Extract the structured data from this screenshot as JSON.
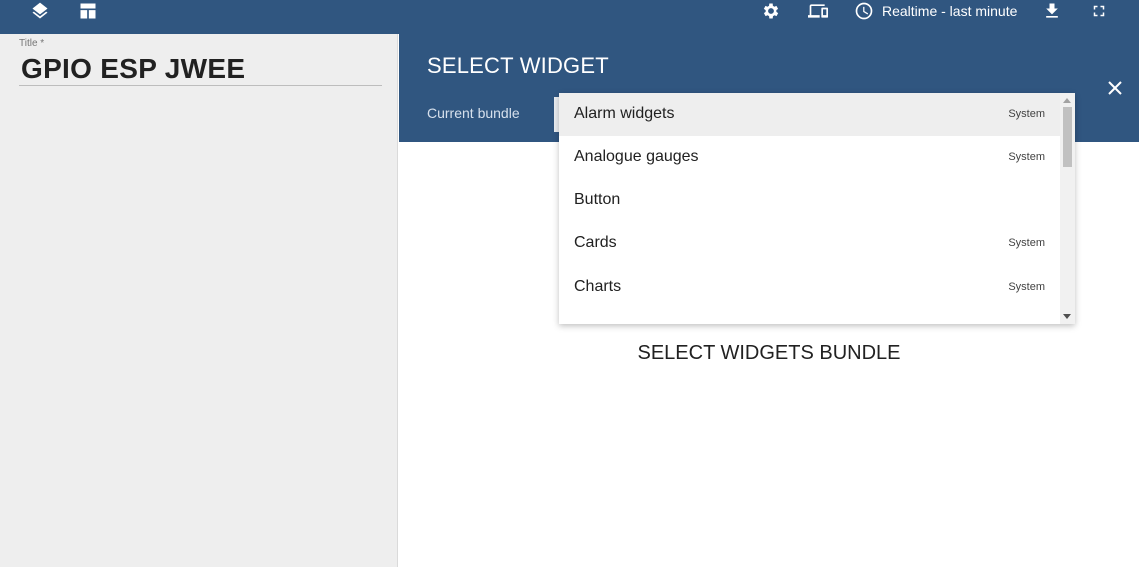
{
  "toolbar": {
    "left_icons": [
      "layers-icon",
      "dashboard-layout-icon"
    ],
    "right_icons": [
      "gear-icon",
      "devices-icon",
      "download-icon",
      "fullscreen-icon"
    ],
    "timewindow_label": "Realtime - last minute"
  },
  "left_panel": {
    "title_label": "Title *",
    "title_value": "GPIO ESP JWEE"
  },
  "right_panel": {
    "header_title": "SELECT WIDGET",
    "bundle_label": "Current bundle",
    "empty_message": "SELECT WIDGETS BUNDLE"
  },
  "bundle_dropdown": {
    "items": [
      {
        "name": "Alarm widgets",
        "tag": "System",
        "highlighted": true
      },
      {
        "name": "Analogue gauges",
        "tag": "System",
        "highlighted": false
      },
      {
        "name": "Button",
        "tag": "",
        "highlighted": false
      },
      {
        "name": "Cards",
        "tag": "System",
        "highlighted": false
      },
      {
        "name": "Charts",
        "tag": "System",
        "highlighted": false
      }
    ]
  },
  "colors": {
    "primary": "#305680",
    "left_panel_bg": "#eeeeee",
    "highlight": "#eeeeee"
  }
}
